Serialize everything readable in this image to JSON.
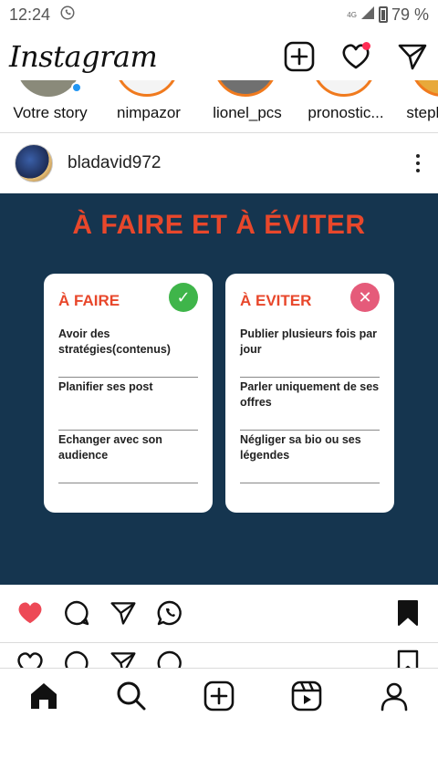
{
  "status_bar": {
    "time": "12:24",
    "network": "4G",
    "battery": "79 %"
  },
  "header": {
    "logo": "Instagram"
  },
  "stories": [
    {
      "name": "Votre story",
      "own": true
    },
    {
      "name": "nimpazor",
      "own": false
    },
    {
      "name": "lionel_pcs",
      "own": false
    },
    {
      "name": "pronostic...",
      "own": false
    },
    {
      "name": "stephenc...",
      "own": false
    }
  ],
  "post": {
    "username": "bladavid972",
    "image": {
      "title": "À FAIRE ET À ÉVITER",
      "do_card": {
        "title": "À FAIRE",
        "items": [
          "Avoir des stratégies(contenus)",
          "Planifier ses post",
          "Echanger avec son audience"
        ]
      },
      "dont_card": {
        "title": "À EVITER",
        "items": [
          "Publier plusieurs fois par jour",
          "Parler uniquement de ses offres",
          "Négliger sa bio ou ses légendes"
        ]
      }
    },
    "liked": true,
    "saved": true
  },
  "colors": {
    "accent_red": "#e8472b",
    "post_bg": "#15354f",
    "like_red": "#ed4956",
    "check_green": "#3fb54a",
    "cross_pink": "#e55b7a"
  }
}
